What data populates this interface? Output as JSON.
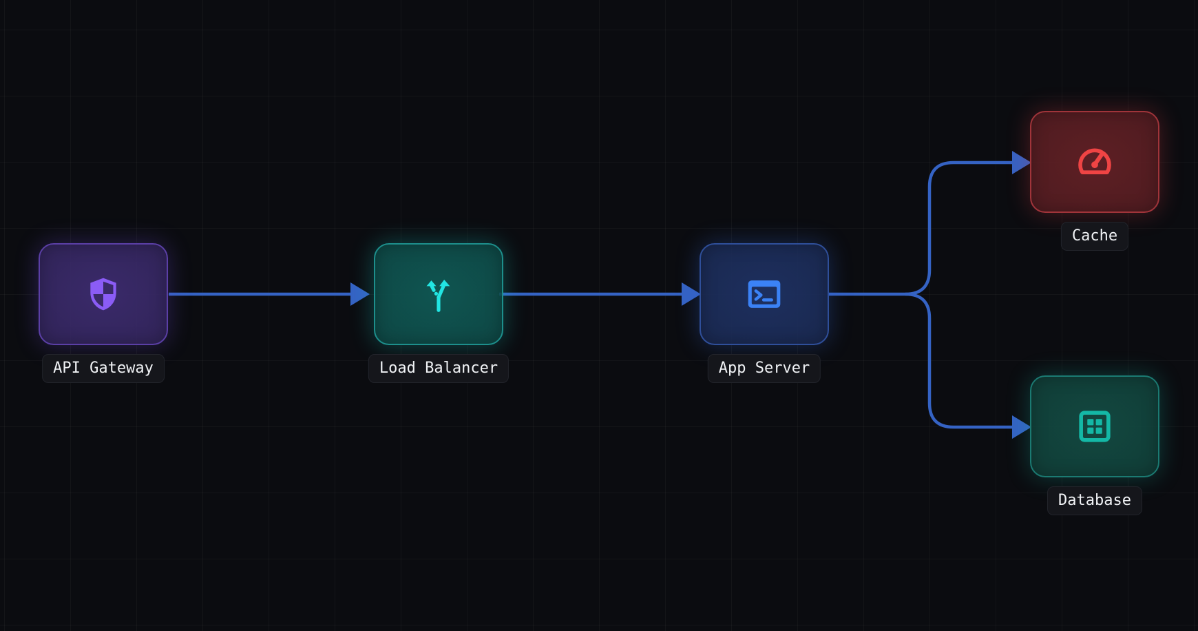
{
  "diagram": {
    "nodes": [
      {
        "id": "api-gateway",
        "label": "API Gateway",
        "icon": "shield-icon",
        "border_color": "#5b3fa6",
        "fill_color": "#3a2a6a",
        "icon_color": "#8b5cf6",
        "glow_color": "#6d4ad6"
      },
      {
        "id": "load-balancer",
        "label": "Load Balancer",
        "icon": "split-arrows-icon",
        "border_color": "#1d8f8c",
        "fill_color": "#0f5551",
        "icon_color": "#22e5e2",
        "glow_color": "#18c9c4"
      },
      {
        "id": "app-server",
        "label": "App Server",
        "icon": "terminal-icon",
        "border_color": "#2f4f9a",
        "fill_color": "#1d2f5e",
        "icon_color": "#3b82f6",
        "glow_color": "#3466d6"
      },
      {
        "id": "cache",
        "label": "Cache",
        "icon": "gauge-icon",
        "border_color": "#a0343a",
        "fill_color": "#5e1f24",
        "icon_color": "#ef4444",
        "glow_color": "#d23a40"
      },
      {
        "id": "database",
        "label": "Database",
        "icon": "grid-icon",
        "border_color": "#1b7a72",
        "fill_color": "#124840",
        "icon_color": "#14b8a6",
        "glow_color": "#15a596"
      }
    ],
    "edges": [
      {
        "from": "api-gateway",
        "to": "load-balancer"
      },
      {
        "from": "load-balancer",
        "to": "app-server"
      },
      {
        "from": "app-server",
        "to": "cache"
      },
      {
        "from": "app-server",
        "to": "database"
      }
    ],
    "edge_color": "#3563c4"
  }
}
